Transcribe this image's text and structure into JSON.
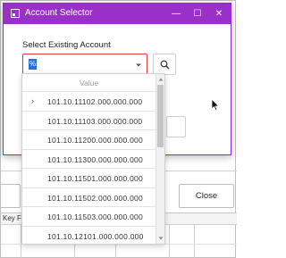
{
  "dialog": {
    "title": "Account Selector",
    "section_label": "Select Existing Account",
    "input_value": "%"
  },
  "window_controls": {
    "minimize": "—",
    "maximize": "☐",
    "close": "✕"
  },
  "dropdown": {
    "column_header": "Value",
    "rows": [
      {
        "value": "101.10.11102.000.000.000",
        "expander": "›"
      },
      {
        "value": "101.10.11103.000.000.000",
        "expander": ""
      },
      {
        "value": "101.10.11200.000.000.000",
        "expander": ""
      },
      {
        "value": "101.10.11300.000.000.000",
        "expander": ""
      },
      {
        "value": "101.10.11501.000.000.000",
        "expander": ""
      },
      {
        "value": "101.10.11502.000.000.000",
        "expander": ""
      },
      {
        "value": "101.10.11503.000.000.000",
        "expander": ""
      },
      {
        "value": "101.10.12101.000.000.000",
        "expander": ""
      }
    ]
  },
  "background": {
    "close_button": "Close",
    "grid_header_fragment": "Key Fl"
  },
  "colors": {
    "titlebar": "#9b30c8",
    "input_border_error": "#e03a3a",
    "selection": "#2e6cd6"
  }
}
